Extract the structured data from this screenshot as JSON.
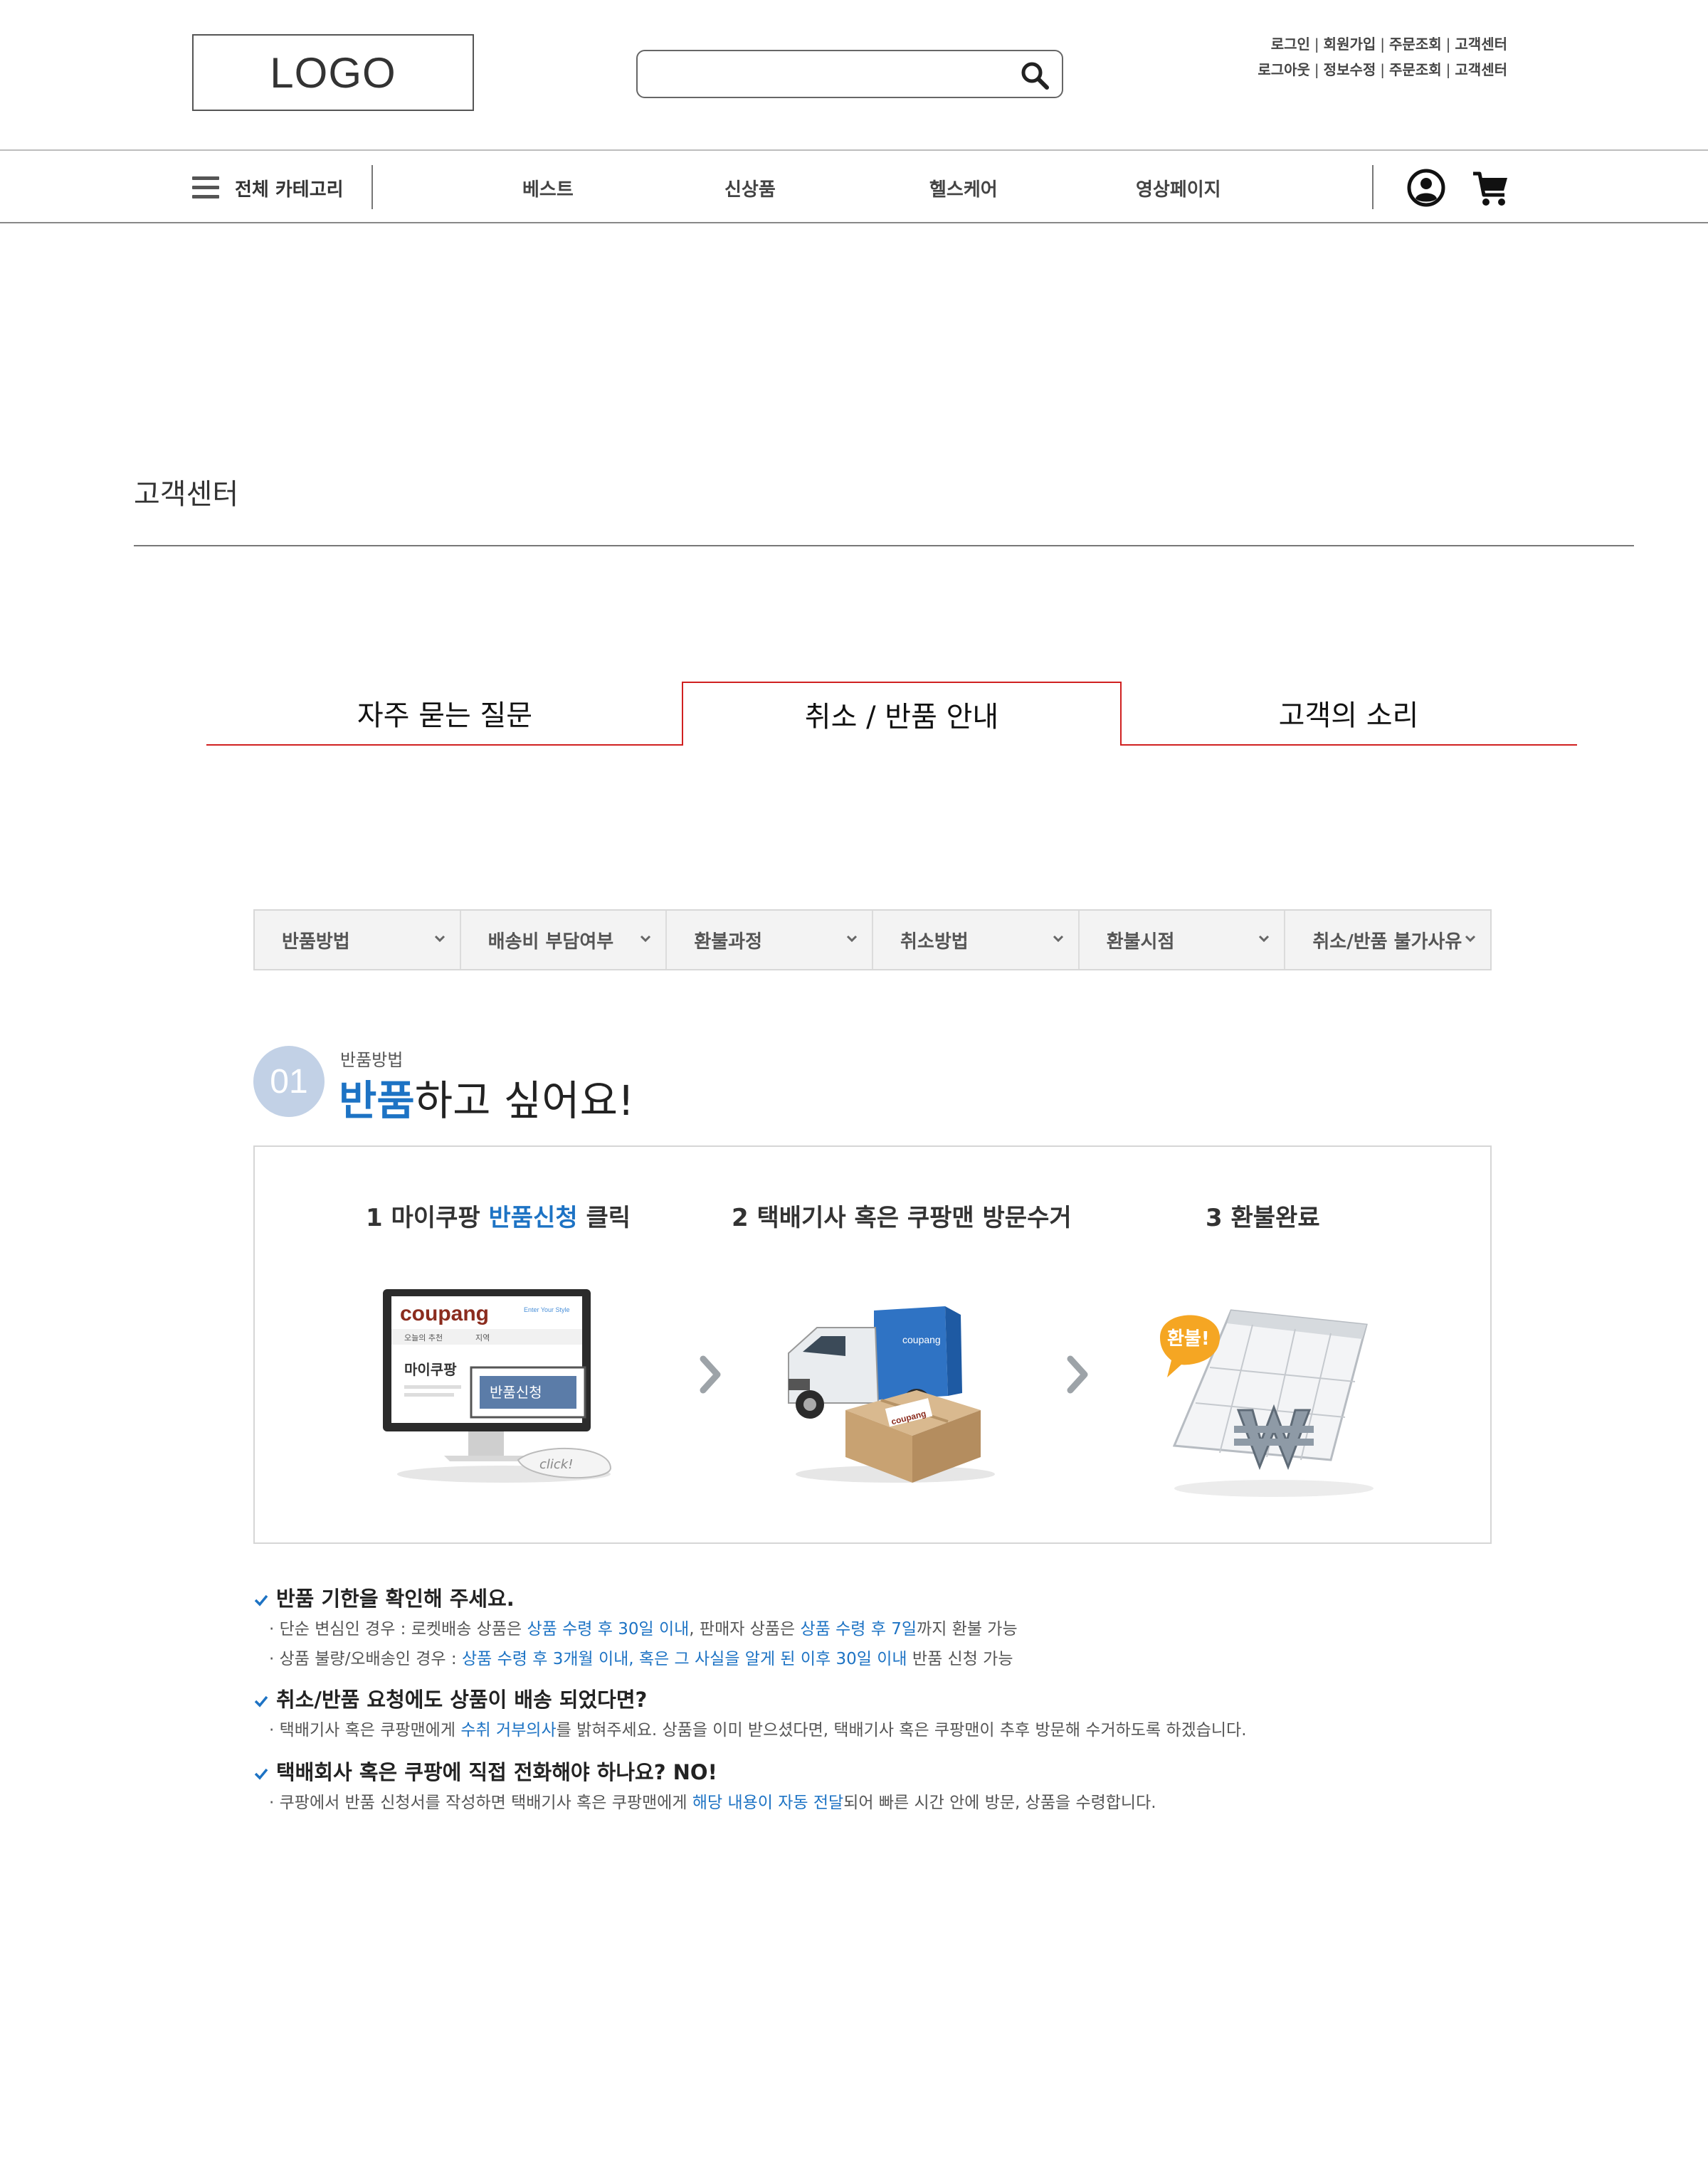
{
  "header": {
    "logo": "LOGO",
    "search_placeholder": "",
    "links_row1": [
      "로그인",
      "회원가입",
      "주문조회",
      "고객센터"
    ],
    "links_row2": [
      "로그아웃",
      "정보수정",
      "주문조회",
      "고객센터"
    ]
  },
  "nav": {
    "category_label": "전체 카테고리",
    "items": [
      "베스트",
      "신상품",
      "헬스케어",
      "영상페이지"
    ]
  },
  "page": {
    "title": "고객센터"
  },
  "tabs": [
    {
      "label": "자주 묻는 질문",
      "active": false
    },
    {
      "label": "취소 / 반품 안내",
      "active": true
    },
    {
      "label": "고객의 소리",
      "active": false
    }
  ],
  "dropdowns": [
    "반품방법",
    "배송비 부담여부",
    "환불과정",
    "취소방법",
    "환불시점",
    "취소/반품 불가사유"
  ],
  "section": {
    "number": "01",
    "subtitle": "반품방법",
    "title_highlight": "반품",
    "title_rest": "하고 싶어요!"
  },
  "process": {
    "step1": {
      "num": "1",
      "pre": "마이쿠팡",
      "highlight": "반품신청",
      "post": "클릭"
    },
    "step2": {
      "label": "2 택배기사 혹은 쿠팡맨 방문수거"
    },
    "step3": {
      "label": "3 환불완료"
    },
    "illustration1": {
      "brand": "coupang",
      "tagline": "Enter Your Style",
      "tab1": "오늘의 추천",
      "tab2": "지역",
      "section": "마이쿠팡",
      "button": "반품신청",
      "click": "click!"
    },
    "illustration2": {
      "truck_brand": "coupang",
      "box_brand": "coupang"
    },
    "illustration3": {
      "bubble": "환불!",
      "symbol": "₩"
    }
  },
  "notes": [
    {
      "heading": "반품 기한을 확인해 주세요.",
      "lines": [
        [
          {
            "t": "· 단순 변심인 경우 : 로켓배송 상품은 ",
            "hl": false
          },
          {
            "t": "상품 수령 후 30일 이내",
            "hl": true
          },
          {
            "t": ", 판매자 상품은 ",
            "hl": false
          },
          {
            "t": "상품 수령 후 7일",
            "hl": true
          },
          {
            "t": "까지 환불 가능",
            "hl": false
          }
        ],
        [
          {
            "t": "· 상품 불량/오배송인 경우 : ",
            "hl": false
          },
          {
            "t": "상품 수령 후  3개월 이내, 혹은 그 사실을 알게 된 이후 30일 이내",
            "hl": true
          },
          {
            "t": " 반품 신청 가능",
            "hl": false
          }
        ]
      ]
    },
    {
      "heading": "취소/반품 요청에도 상품이 배송 되었다면?",
      "lines": [
        [
          {
            "t": "· 택배기사 혹은 쿠팡맨에게 ",
            "hl": false
          },
          {
            "t": "수취 거부의사",
            "hl": true
          },
          {
            "t": "를 밝혀주세요. 상품을 이미 받으셨다면, 택배기사 혹은 쿠팡맨이 추후 방문해 수거하도록 하겠습니다.",
            "hl": false
          }
        ]
      ]
    },
    {
      "heading": "택배회사 혹은 쿠팡에 직접 전화해야 하나요? NO!",
      "lines": [
        [
          {
            "t": "· 쿠팡에서 반품 신청서를 작성하면 택배기사 혹은 쿠팡맨에게 ",
            "hl": false
          },
          {
            "t": "해당 내용이 자동 전달",
            "hl": true
          },
          {
            "t": "되어 빠른 시간 안에 방문, 상품을 수령합니다.",
            "hl": false
          }
        ]
      ]
    }
  ],
  "colors": {
    "accent_blue": "#1d73c4",
    "tab_red": "#d02020",
    "circle_blue": "#c2d1e6"
  }
}
